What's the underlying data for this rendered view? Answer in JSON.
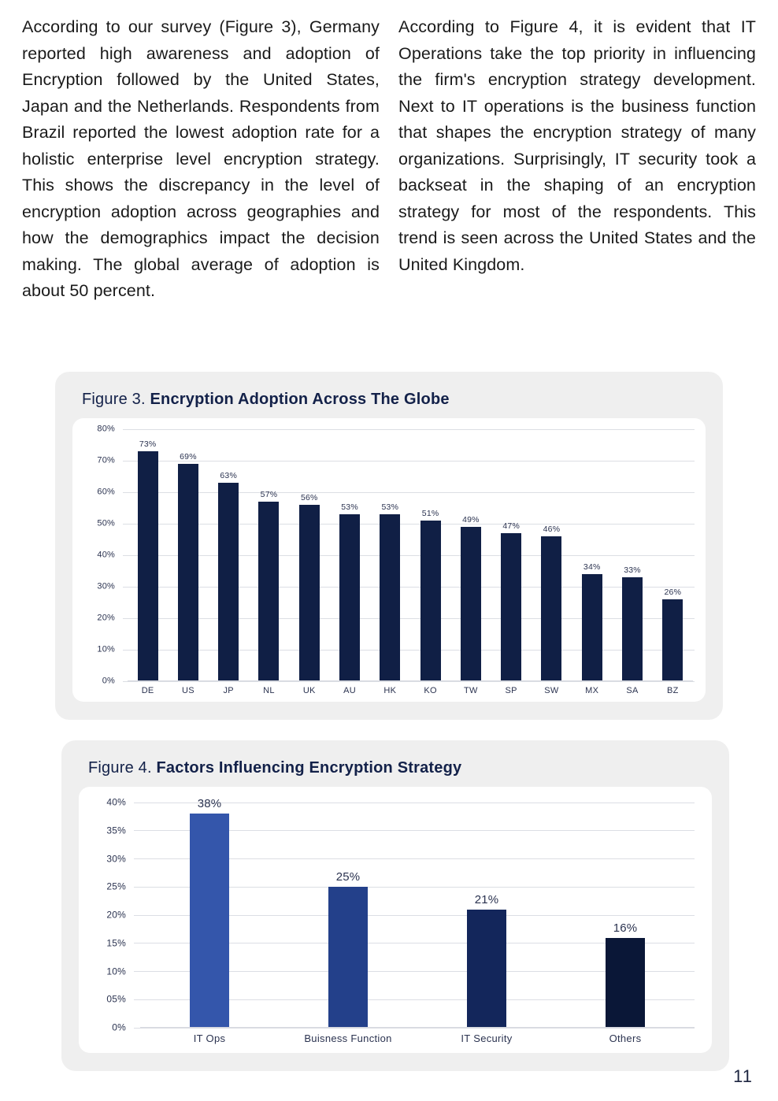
{
  "body_text": {
    "left_column": "According to our survey (Figure 3), Germany reported high awareness and adoption of Encryption followed by the United States, Japan and the Netherlands. Respondents from Brazil reported the lowest adoption rate for a holistic enterprise level encryption strategy. This shows the discrepancy in the level of encryption adoption across geographies and how the demographics impact the decision making. The global average of adoption is about 50 percent.",
    "right_column": "According to Figure 4, it is evident that IT Operations take the top priority in influencing the firm's encryption strategy development. Next to IT operations is the business function that shapes the encryption strategy of many organizations. Surprisingly, IT security took a backseat in the shaping of an encryption strategy for most of the respondents. This trend is seen across the United States and the United Kingdom."
  },
  "figure3": {
    "caption_label": "Figure 3.",
    "caption_title": "Encryption Adoption Across The Globe"
  },
  "figure4": {
    "caption_label": "Figure 4.",
    "caption_title": "Factors Influencing Encryption Strategy"
  },
  "page_number": "11",
  "colors": {
    "card_background": "#efefef",
    "plot_background": "#ffffff",
    "caption_text": "#132149",
    "gridline": "#dcdee4",
    "axis_text": "#2b3350",
    "bar_navy": "#101f45",
    "bar_blue_bright": "#3456ab",
    "bar_blue_medium": "#23408a",
    "bar_navy_dark": "#13265b",
    "bar_navy_darkest": "#0a1737"
  },
  "chart_data": [
    {
      "id": "figure3",
      "type": "bar",
      "title": "Figure 3. Encryption Adoption Across The Globe",
      "xlabel": "",
      "ylabel": "",
      "ylim": [
        0,
        80
      ],
      "grid": true,
      "legend": "none",
      "y_ticks": [
        "80%",
        "70%",
        "60%",
        "50%",
        "40%",
        "30%",
        "20%",
        "10%",
        "0%"
      ],
      "y_tick_values": [
        80,
        70,
        60,
        50,
        40,
        30,
        20,
        10,
        0
      ],
      "categories": [
        "DE",
        "US",
        "JP",
        "NL",
        "UK",
        "AU",
        "HK",
        "KO",
        "TW",
        "SP",
        "SW",
        "MX",
        "SA",
        "BZ"
      ],
      "values": [
        73,
        69,
        63,
        57,
        56,
        53,
        53,
        51,
        49,
        47,
        46,
        34,
        33,
        26
      ],
      "labels": [
        "73%",
        "69%",
        "63%",
        "57%",
        "56%",
        "53%",
        "53%",
        "51%",
        "49%",
        "47%",
        "46%",
        "34%",
        "33%",
        "26%"
      ],
      "bar_colors": [
        "#101f45",
        "#101f45",
        "#101f45",
        "#101f45",
        "#101f45",
        "#101f45",
        "#101f45",
        "#101f45",
        "#101f45",
        "#101f45",
        "#101f45",
        "#101f45",
        "#101f45",
        "#101f45"
      ]
    },
    {
      "id": "figure4",
      "type": "bar",
      "title": "Figure 4. Factors Influencing Encryption Strategy",
      "xlabel": "",
      "ylabel": "",
      "ylim": [
        0,
        40
      ],
      "grid": true,
      "legend": "none",
      "y_ticks": [
        "40%",
        "35%",
        "30%",
        "25%",
        "20%",
        "15%",
        "10%",
        "05%",
        "0%"
      ],
      "y_tick_values": [
        40,
        35,
        30,
        25,
        20,
        15,
        10,
        5,
        0
      ],
      "categories": [
        "IT Ops",
        "Buisness Function",
        "IT Security",
        "Others"
      ],
      "values": [
        38,
        25,
        21,
        16
      ],
      "labels": [
        "38%",
        "25%",
        "21%",
        "16%"
      ],
      "bar_colors": [
        "#3456ab",
        "#23408a",
        "#13265b",
        "#0a1737"
      ]
    }
  ]
}
